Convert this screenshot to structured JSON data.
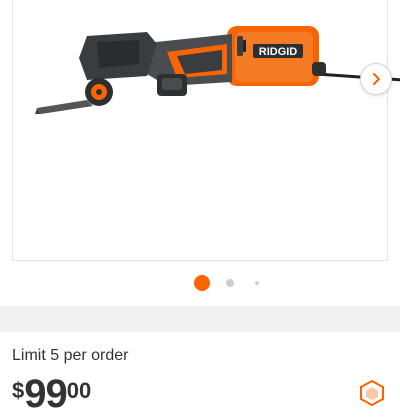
{
  "product": {
    "brand_label": "RIDGID",
    "image_icon": "oscillating-multi-tool-image"
  },
  "carousel": {
    "next_icon": "chevron-right-icon",
    "dots": [
      "active",
      "inactive",
      "inactive"
    ]
  },
  "purchase": {
    "limit_text": "Limit 5 per order",
    "price_currency": "$",
    "price_dollars": "99",
    "price_cents": "00"
  },
  "colors": {
    "accent": "#f96302",
    "tool_body": "#3a3d40",
    "text": "#333333"
  },
  "icons": {
    "store_badge": "store-hexagon-icon"
  }
}
